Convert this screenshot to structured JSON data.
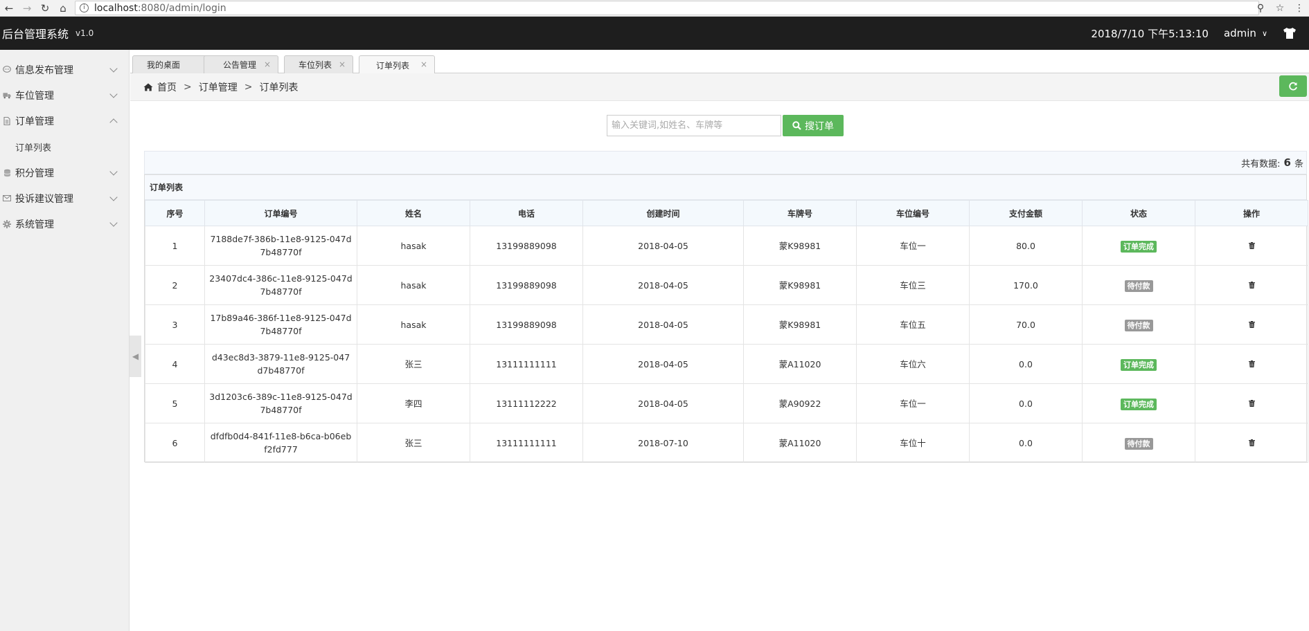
{
  "browser": {
    "url_host": "localhost",
    "url_path": ":8080/admin/login"
  },
  "header": {
    "title": "后台管理系统",
    "version": "v1.0",
    "datetime": "2018/7/10 下午5:13:10",
    "user": "admin"
  },
  "sidebar": {
    "items": [
      {
        "label": "信息发布管理",
        "icon": "chat-icon"
      },
      {
        "label": "车位管理",
        "icon": "truck-icon"
      },
      {
        "label": "订单管理",
        "icon": "file-icon"
      },
      {
        "label": "积分管理",
        "icon": "database-icon"
      },
      {
        "label": "投诉建议管理",
        "icon": "envelope-icon"
      },
      {
        "label": "系统管理",
        "icon": "gear-icon"
      }
    ],
    "subitem": "订单列表"
  },
  "tabs": [
    {
      "label": "我的桌面"
    },
    {
      "label": "公告管理"
    },
    {
      "label": "车位列表"
    },
    {
      "label": "订单列表"
    }
  ],
  "breadcrumb": {
    "home": "首页",
    "level1": "订单管理",
    "level2": "订单列表",
    "sep": ">"
  },
  "search": {
    "placeholder": "输入关键词,如姓名、车牌等",
    "button": "搜订单"
  },
  "total": {
    "prefix": "共有数据:",
    "count": "6",
    "suffix": "条"
  },
  "table": {
    "title": "订单列表",
    "headers": [
      "序号",
      "订单编号",
      "姓名",
      "电话",
      "创建时间",
      "车牌号",
      "车位编号",
      "支付金额",
      "状态",
      "操作"
    ],
    "rows": [
      {
        "no": "1",
        "order_id": "7188de7f-386b-11e8-9125-047d7b48770f",
        "name": "hasak",
        "phone": "13199889098",
        "created": "2018-04-05",
        "plate": "蒙K98981",
        "spot": "车位一",
        "amount": "80.0",
        "status": "订单完成",
        "status_type": "done"
      },
      {
        "no": "2",
        "order_id": "23407dc4-386c-11e8-9125-047d7b48770f",
        "name": "hasak",
        "phone": "13199889098",
        "created": "2018-04-05",
        "plate": "蒙K98981",
        "spot": "车位三",
        "amount": "170.0",
        "status": "待付款",
        "status_type": "wait"
      },
      {
        "no": "3",
        "order_id": "17b89a46-386f-11e8-9125-047d7b48770f",
        "name": "hasak",
        "phone": "13199889098",
        "created": "2018-04-05",
        "plate": "蒙K98981",
        "spot": "车位五",
        "amount": "70.0",
        "status": "待付款",
        "status_type": "wait"
      },
      {
        "no": "4",
        "order_id": "d43ec8d3-3879-11e8-9125-047d7b48770f",
        "name": "张三",
        "phone": "13111111111",
        "created": "2018-04-05",
        "plate": "蒙A11020",
        "spot": "车位六",
        "amount": "0.0",
        "status": "订单完成",
        "status_type": "done"
      },
      {
        "no": "5",
        "order_id": "3d1203c6-389c-11e8-9125-047d7b48770f",
        "name": "李四",
        "phone": "13111112222",
        "created": "2018-04-05",
        "plate": "蒙A90922",
        "spot": "车位一",
        "amount": "0.0",
        "status": "订单完成",
        "status_type": "done"
      },
      {
        "no": "6",
        "order_id": "dfdfb0d4-841f-11e8-b6ca-b06ebf2fd777",
        "name": "张三",
        "phone": "13111111111",
        "created": "2018-07-10",
        "plate": "蒙A11020",
        "spot": "车位十",
        "amount": "0.0",
        "status": "待付款",
        "status_type": "wait"
      }
    ]
  },
  "colors": {
    "success": "#5cb85c",
    "muted_badge": "#999999",
    "header_bg": "#1e1e1e"
  }
}
